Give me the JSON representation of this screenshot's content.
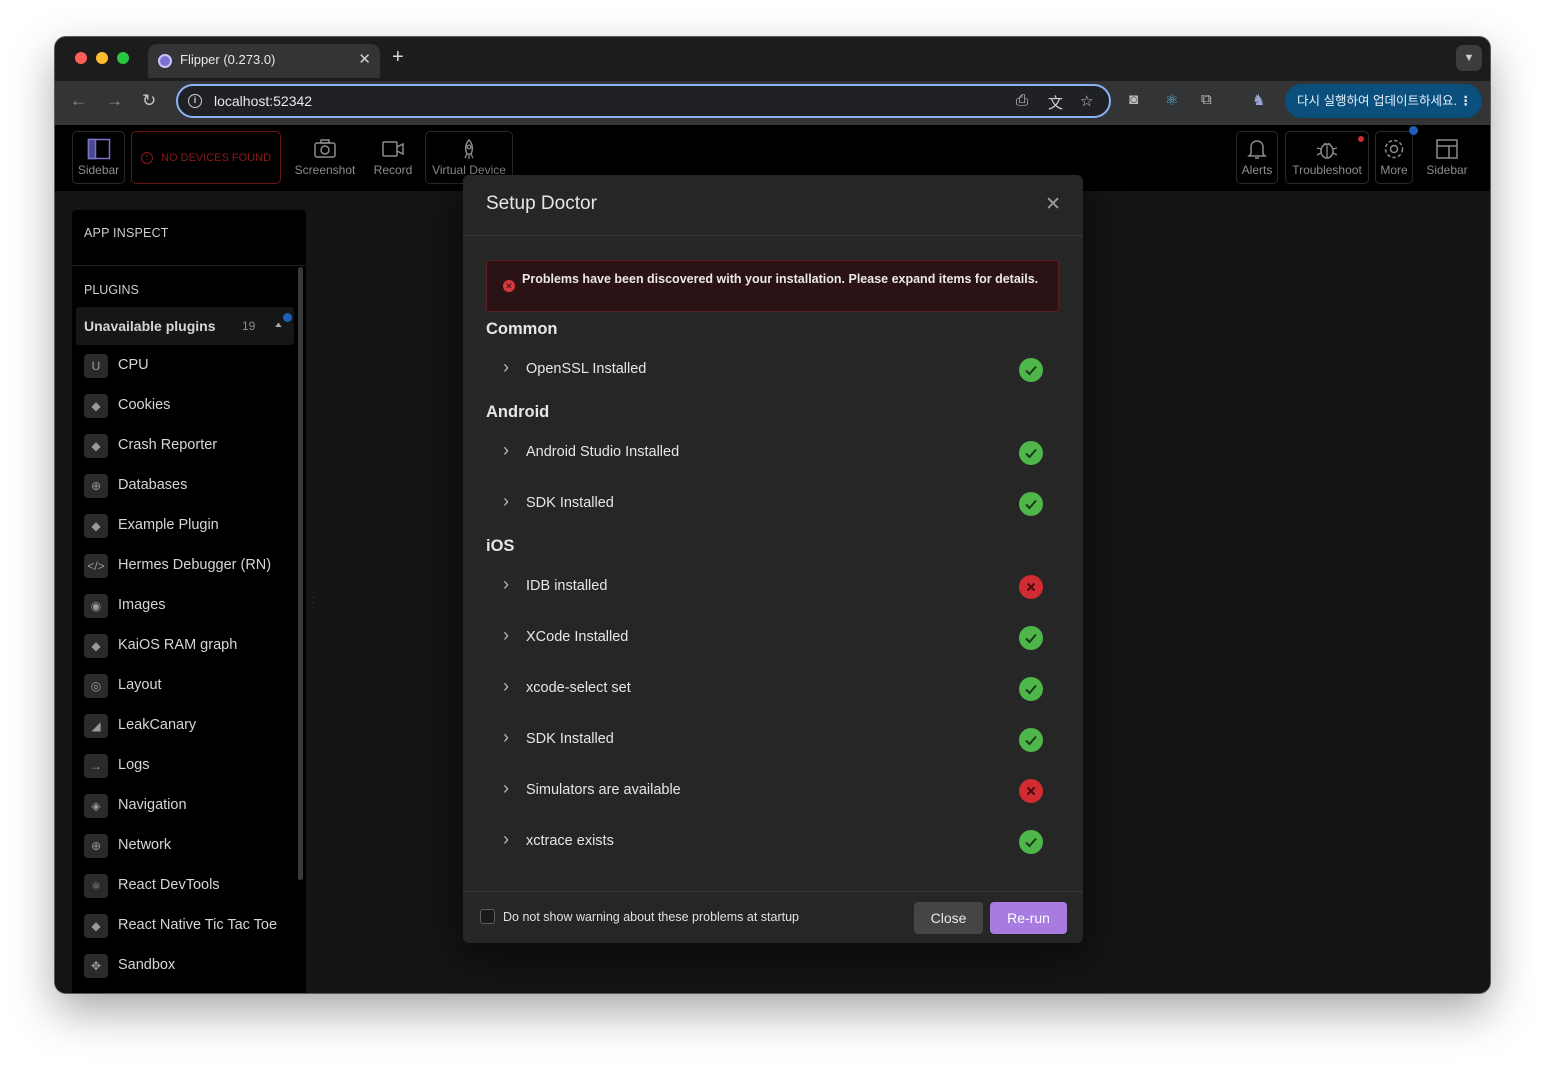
{
  "browser": {
    "tab_title": "Flipper (0.273.0)",
    "url": "localhost:52342",
    "update_text": "다시 실행하여 업데이트하세요.",
    "traffic_colors": [
      "#ff5f57",
      "#febc2e",
      "#28c840"
    ]
  },
  "topbar": {
    "sidebar_left": "Sidebar",
    "no_devices": "NO DEVICES FOUND",
    "screenshot": "Screenshot",
    "record": "Record",
    "virtual_device": "Virtual Device",
    "alerts": "Alerts",
    "troubleshoot": "Troubleshoot",
    "more": "More",
    "sidebar_right": "Sidebar"
  },
  "sidebar": {
    "app_inspect": "APP INSPECT",
    "plugins_heading": "PLUGINS",
    "group_label": "Unavailable plugins",
    "group_count": "19",
    "plugins": [
      {
        "label": "CPU",
        "icon": "cpu-icon",
        "glyph": "U"
      },
      {
        "label": "Cookies",
        "icon": "cube-icon",
        "glyph": "◆"
      },
      {
        "label": "Crash Reporter",
        "icon": "cube-icon",
        "glyph": "◆"
      },
      {
        "label": "Databases",
        "icon": "globe-icon",
        "glyph": "⊕"
      },
      {
        "label": "Example Plugin",
        "icon": "cube-icon",
        "glyph": "◆"
      },
      {
        "label": "Hermes Debugger (RN)",
        "icon": "code-icon",
        "glyph": "</>"
      },
      {
        "label": "Images",
        "icon": "user-circle-icon",
        "glyph": "◉"
      },
      {
        "label": "KaiOS RAM graph",
        "icon": "cube-icon",
        "glyph": "◆"
      },
      {
        "label": "Layout",
        "icon": "target-icon",
        "glyph": "◎"
      },
      {
        "label": "LeakCanary",
        "icon": "bird-icon",
        "glyph": "◢"
      },
      {
        "label": "Logs",
        "icon": "arrow-right-icon",
        "glyph": "→"
      },
      {
        "label": "Navigation",
        "icon": "compass-icon",
        "glyph": "◈"
      },
      {
        "label": "Network",
        "icon": "globe-icon",
        "glyph": "⊕"
      },
      {
        "label": "React DevTools",
        "icon": "react-icon",
        "glyph": "⚛"
      },
      {
        "label": "React Native Tic Tac Toe",
        "icon": "cube-icon",
        "glyph": "◆"
      },
      {
        "label": "Sandbox",
        "icon": "sandbox-icon",
        "glyph": "✥"
      }
    ]
  },
  "modal": {
    "title": "Setup Doctor",
    "alert": "Problems have been discovered with your installation. Please expand items for details.",
    "sections": [
      {
        "title": "Common",
        "items": [
          {
            "label": "OpenSSL Installed",
            "status": "ok"
          }
        ]
      },
      {
        "title": "Android",
        "items": [
          {
            "label": "Android Studio Installed",
            "status": "ok"
          },
          {
            "label": "SDK Installed",
            "status": "ok"
          }
        ]
      },
      {
        "title": "iOS",
        "items": [
          {
            "label": "IDB installed",
            "status": "fail"
          },
          {
            "label": "XCode Installed",
            "status": "ok"
          },
          {
            "label": "xcode-select set",
            "status": "ok"
          },
          {
            "label": "SDK Installed",
            "status": "ok"
          },
          {
            "label": "Simulators are available",
            "status": "fail"
          },
          {
            "label": "xctrace exists",
            "status": "ok"
          }
        ]
      }
    ],
    "checkbox_label": "Do not show warning about these problems at startup",
    "checkbox_checked": false,
    "close_label": "Close",
    "rerun_label": "Re-run",
    "colors": {
      "ok": "#4fb64a",
      "fail": "#d02c31",
      "accent": "#a87be0"
    }
  }
}
